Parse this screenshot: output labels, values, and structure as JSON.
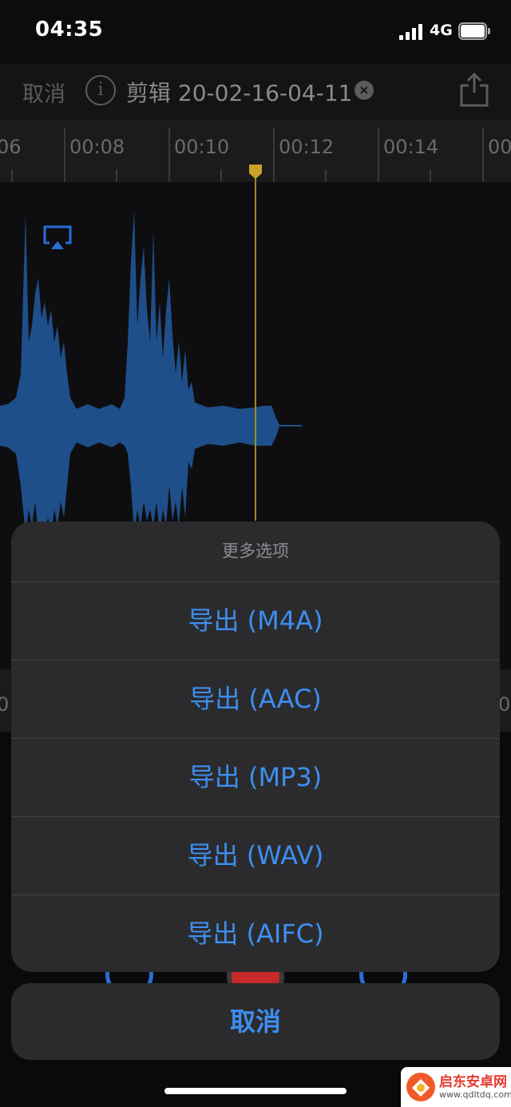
{
  "status_bar": {
    "time": "04:35",
    "network": "4G"
  },
  "nav": {
    "cancel_label": "取消",
    "title": "剪辑 20-02-16-04-11"
  },
  "timeline": {
    "labels": [
      "06",
      "00:08",
      "00:10",
      "00:12",
      "00:14",
      "00"
    ]
  },
  "bottom_ruler": {
    "left_label": "0",
    "right_label": "0"
  },
  "action_sheet": {
    "title": "更多选项",
    "items": [
      "导出 (M4A)",
      "导出 (AAC)",
      "导出 (MP3)",
      "导出 (WAV)",
      "导出 (AIFC)"
    ],
    "cancel_label": "取消"
  },
  "watermark": {
    "name": "启东安卓网",
    "url": "www.qdltdq.com"
  },
  "colors": {
    "accent": "#3d8ef0",
    "waveform": "#1f4f8a",
    "playhead": "#c9a227",
    "record": "#c62a2a"
  },
  "icons": [
    "info-icon",
    "clear-icon",
    "share-icon",
    "airplay-icon",
    "playhead-icon"
  ]
}
